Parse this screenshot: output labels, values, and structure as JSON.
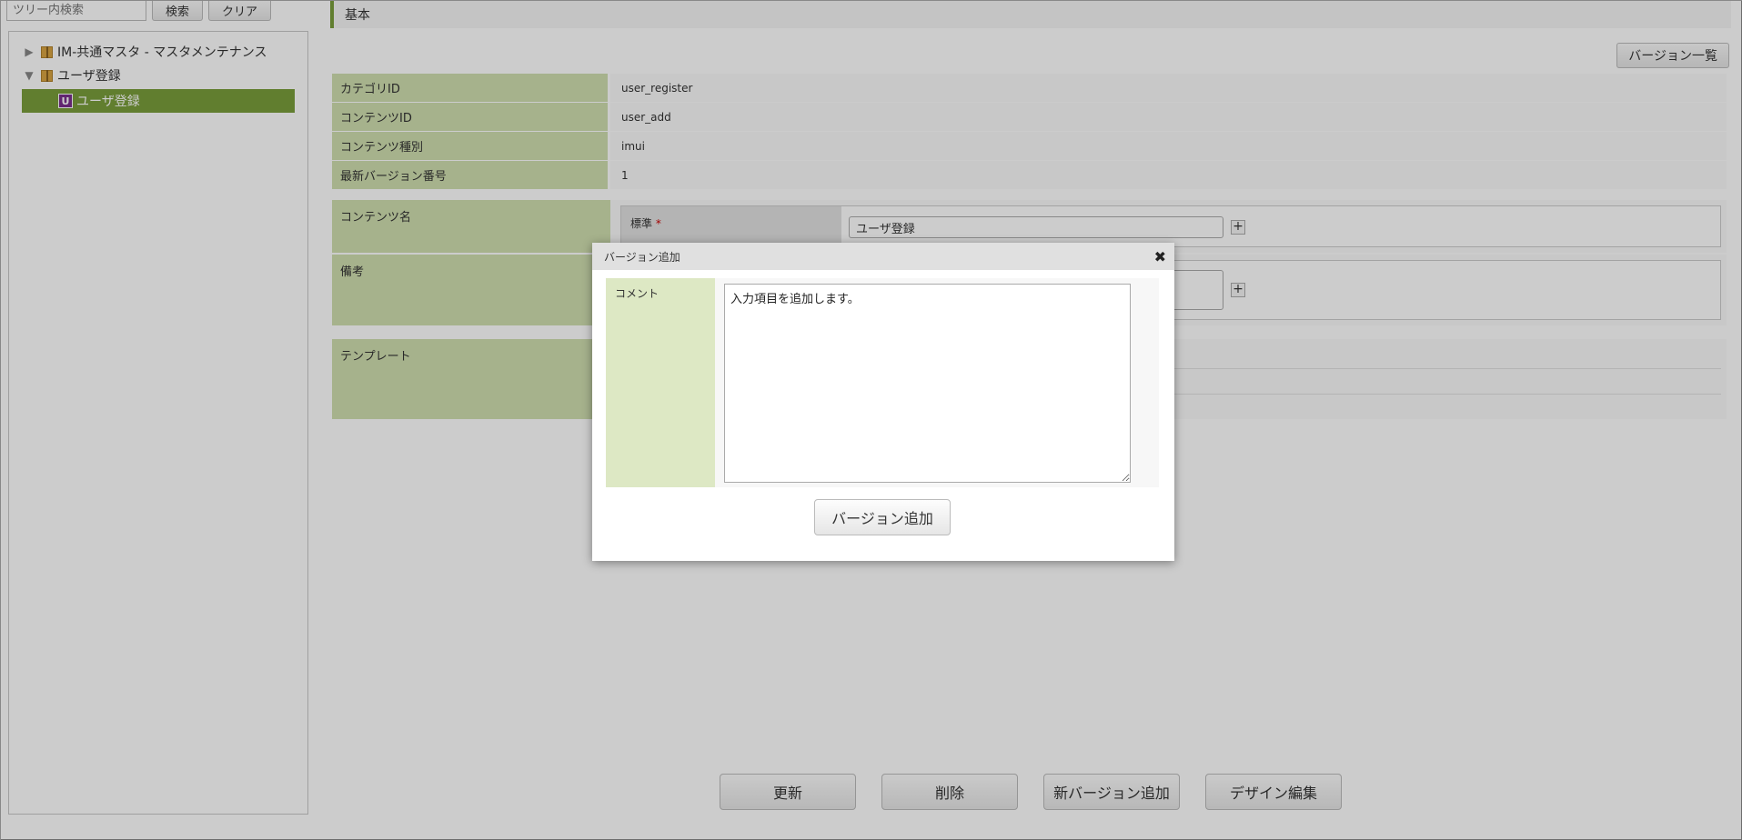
{
  "search": {
    "placeholder": "ツリー内検索",
    "search_label": "検索",
    "clear_label": "クリア"
  },
  "tree": {
    "items": [
      {
        "label": "IM-共通マスタ - マスタメンテナンス"
      },
      {
        "label": "ユーザ登録"
      }
    ],
    "selected": {
      "badge": "U",
      "label": "ユーザ登録"
    }
  },
  "section": {
    "title": "基本",
    "version_list_label": "バージョン一覧"
  },
  "info": [
    {
      "label": "カテゴリID",
      "value": "user_register"
    },
    {
      "label": "コンテンツID",
      "value": "user_add"
    },
    {
      "label": "コンテンツ種別",
      "value": "imui"
    },
    {
      "label": "最新バージョン番号",
      "value": "1"
    }
  ],
  "content_name": {
    "label": "コンテンツ名",
    "sub_label": "標準",
    "required_mark": "*",
    "value": "ユーザ登録"
  },
  "remarks": {
    "label": "備考"
  },
  "template": {
    "label": "テンプレート"
  },
  "actions": {
    "update": "更新",
    "delete": "削除",
    "new_version": "新バージョン追加",
    "design_edit": "デザイン編集"
  },
  "modal": {
    "title": "バージョン追加",
    "comment_label": "コメント",
    "comment_value": "入力項目を追加します。",
    "submit_label": "バージョン追加"
  },
  "colors": {
    "accent": "#7a9e3b",
    "label_bg": "#d0dfb0",
    "overlay": "rgba(0,0,0,0.2)"
  }
}
